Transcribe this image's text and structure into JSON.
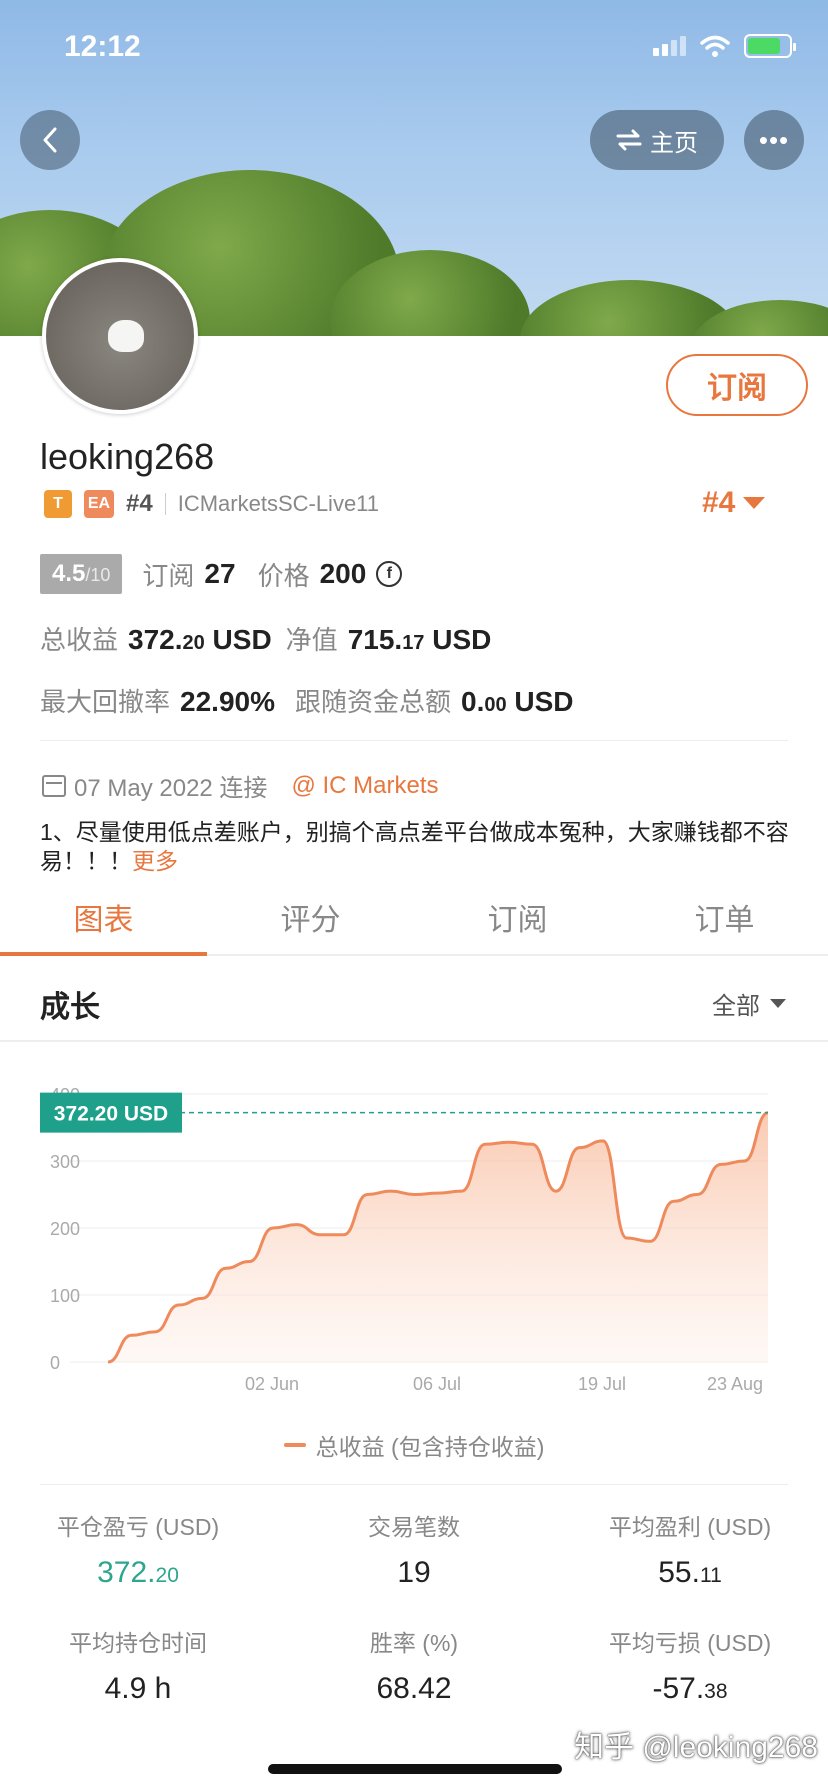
{
  "status_bar": {
    "time": "12:12"
  },
  "header": {
    "home_label": "主页",
    "more_label": "•••"
  },
  "profile": {
    "subscribe_label": "订阅",
    "username": "leoking268",
    "tag_t": "T",
    "tag_ea": "EA",
    "rank_small": "#4",
    "server": "ICMarketsSC-Live11",
    "rank_big": "#4",
    "score": "4.5",
    "score_max": "/10",
    "subs_label": "订阅",
    "subs_value": "27",
    "price_label": "价格",
    "price_value": "200",
    "coin_symbol": "f",
    "total_profit_label": "总收益",
    "total_profit_int": "372.",
    "total_profit_dec": "20",
    "total_profit_unit": "USD",
    "equity_label": "净值",
    "equity_int": "715.",
    "equity_dec": "17",
    "equity_unit": "USD",
    "drawdown_label": "最大回撤率",
    "drawdown_value": "22.90%",
    "follow_label": "跟随资金总额",
    "follow_int": "0.",
    "follow_dec": "00",
    "follow_unit": "USD",
    "connected_text": "07 May 2022 连接",
    "broker_link": "@ IC Markets",
    "description": "1、尽量使用低点差账户，别搞个高点差平台做成本冤种，大家赚钱都不容易！！！",
    "more_link": "更多"
  },
  "tabs": [
    {
      "label": "图表",
      "active": true
    },
    {
      "label": "评分",
      "active": false
    },
    {
      "label": "订阅",
      "active": false
    },
    {
      "label": "订单",
      "active": false
    }
  ],
  "growth": {
    "title": "成长",
    "filter_label": "全部"
  },
  "chart_data": {
    "type": "area",
    "current_label": "372.20 USD",
    "current_value": 372.2,
    "y_ticks": [
      "0",
      "100",
      "200",
      "300",
      "400"
    ],
    "ylim": [
      0,
      400
    ],
    "x_ticks": [
      "02 Jun",
      "06 Jul",
      "19 Jul",
      "23 Aug"
    ],
    "legend": "总收益 (包含持仓收益)",
    "series": [
      {
        "values": [
          0,
          40,
          45,
          85,
          95,
          140,
          150,
          200,
          205,
          190,
          190,
          250,
          255,
          250,
          252,
          255,
          325,
          328,
          325,
          255,
          320,
          330,
          185,
          180,
          240,
          250,
          295,
          300,
          372
        ]
      }
    ],
    "colors": {
      "line": "#ef8a5c",
      "fill": "#fde3d5",
      "marker": "#1ea08a"
    }
  },
  "stats": [
    {
      "label": "平仓盈亏 (USD)",
      "int": "372.",
      "dec": "20",
      "green": true
    },
    {
      "label": "交易笔数",
      "int": "19",
      "dec": "",
      "green": false
    },
    {
      "label": "平均盈利 (USD)",
      "int": "55.",
      "dec": "11",
      "green": false
    },
    {
      "label": "平均持仓时间",
      "int": "4.9 h",
      "dec": "",
      "green": false
    },
    {
      "label": "胜率 (%)",
      "int": "68.42",
      "dec": "",
      "green": false
    },
    {
      "label": "平均亏损 (USD)",
      "int": "-57.",
      "dec": "38",
      "green": false
    }
  ],
  "watermark": "知乎 @leoking268"
}
